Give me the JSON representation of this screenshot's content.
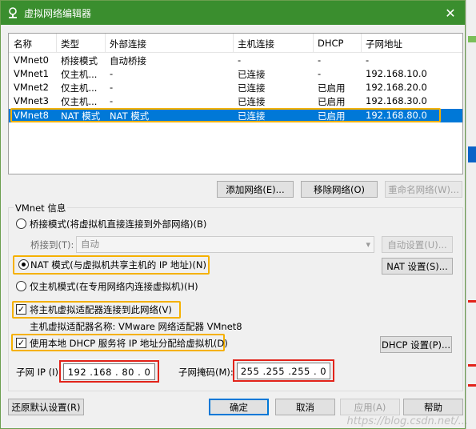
{
  "window": {
    "title": "虚拟网络编辑器",
    "close_glyph": "✕"
  },
  "table": {
    "columns": [
      "名称",
      "类型",
      "外部连接",
      "主机连接",
      "DHCP",
      "子网地址"
    ],
    "rows": [
      [
        "VMnet0",
        "桥接模式",
        "自动桥接",
        "-",
        "-",
        "-"
      ],
      [
        "VMnet1",
        "仅主机...",
        "-",
        "已连接",
        "-",
        "192.168.10.0"
      ],
      [
        "VMnet2",
        "仅主机...",
        "-",
        "已连接",
        "已启用",
        "192.168.20.0"
      ],
      [
        "VMnet3",
        "仅主机...",
        "-",
        "已连接",
        "已启用",
        "192.168.30.0"
      ],
      [
        "VMnet8",
        "NAT 模式",
        "NAT 模式",
        "已连接",
        "已启用",
        "192.168.80.0"
      ]
    ],
    "selected_index": 4
  },
  "buttons": {
    "add_network": "添加网络(E)...",
    "remove_network": "移除网络(O)",
    "rename_network": "重命名网络(W)...",
    "auto_settings": "自动设置(U)...",
    "nat_settings": "NAT 设置(S)...",
    "dhcp_settings": "DHCP 设置(P)...",
    "restore_defaults": "还原默认设置(R)",
    "ok": "确定",
    "cancel": "取消",
    "apply": "应用(A)",
    "help": "帮助"
  },
  "vmnet_info": {
    "group_label": "VMnet 信息",
    "bridged_label": "桥接模式(将虚拟机直接连接到外部网络)(B)",
    "bridge_to_label": "桥接到(T):",
    "bridge_to_value": "自动",
    "nat_label": "NAT 模式(与虚拟机共享主机的 IP 地址)(N)",
    "hostonly_label": "仅主机模式(在专用网络内连接虚拟机)(H)",
    "connect_adapter_label": "将主机虚拟适配器连接到此网络(V)",
    "adapter_name_label": "主机虚拟适配器名称: VMware 网络适配器 VMnet8",
    "use_dhcp_label": "使用本地 DHCP 服务将 IP 地址分配给虚拟机(D)",
    "selected_mode": "nat",
    "connect_adapter_checked": true,
    "use_dhcp_checked": true
  },
  "subnet": {
    "ip_label": "子网 IP (I):",
    "ip_value": "192 .168 . 80  . 0",
    "mask_label": "子网掩码(M):",
    "mask_value": "255 .255 .255 . 0"
  },
  "watermark": "https://blog.csdn.net/...",
  "colors": {
    "title_bar": "#3a8e2e",
    "selection": "#0078d7",
    "highlight_orange": "#f5b100",
    "highlight_red": "#e2231a"
  }
}
